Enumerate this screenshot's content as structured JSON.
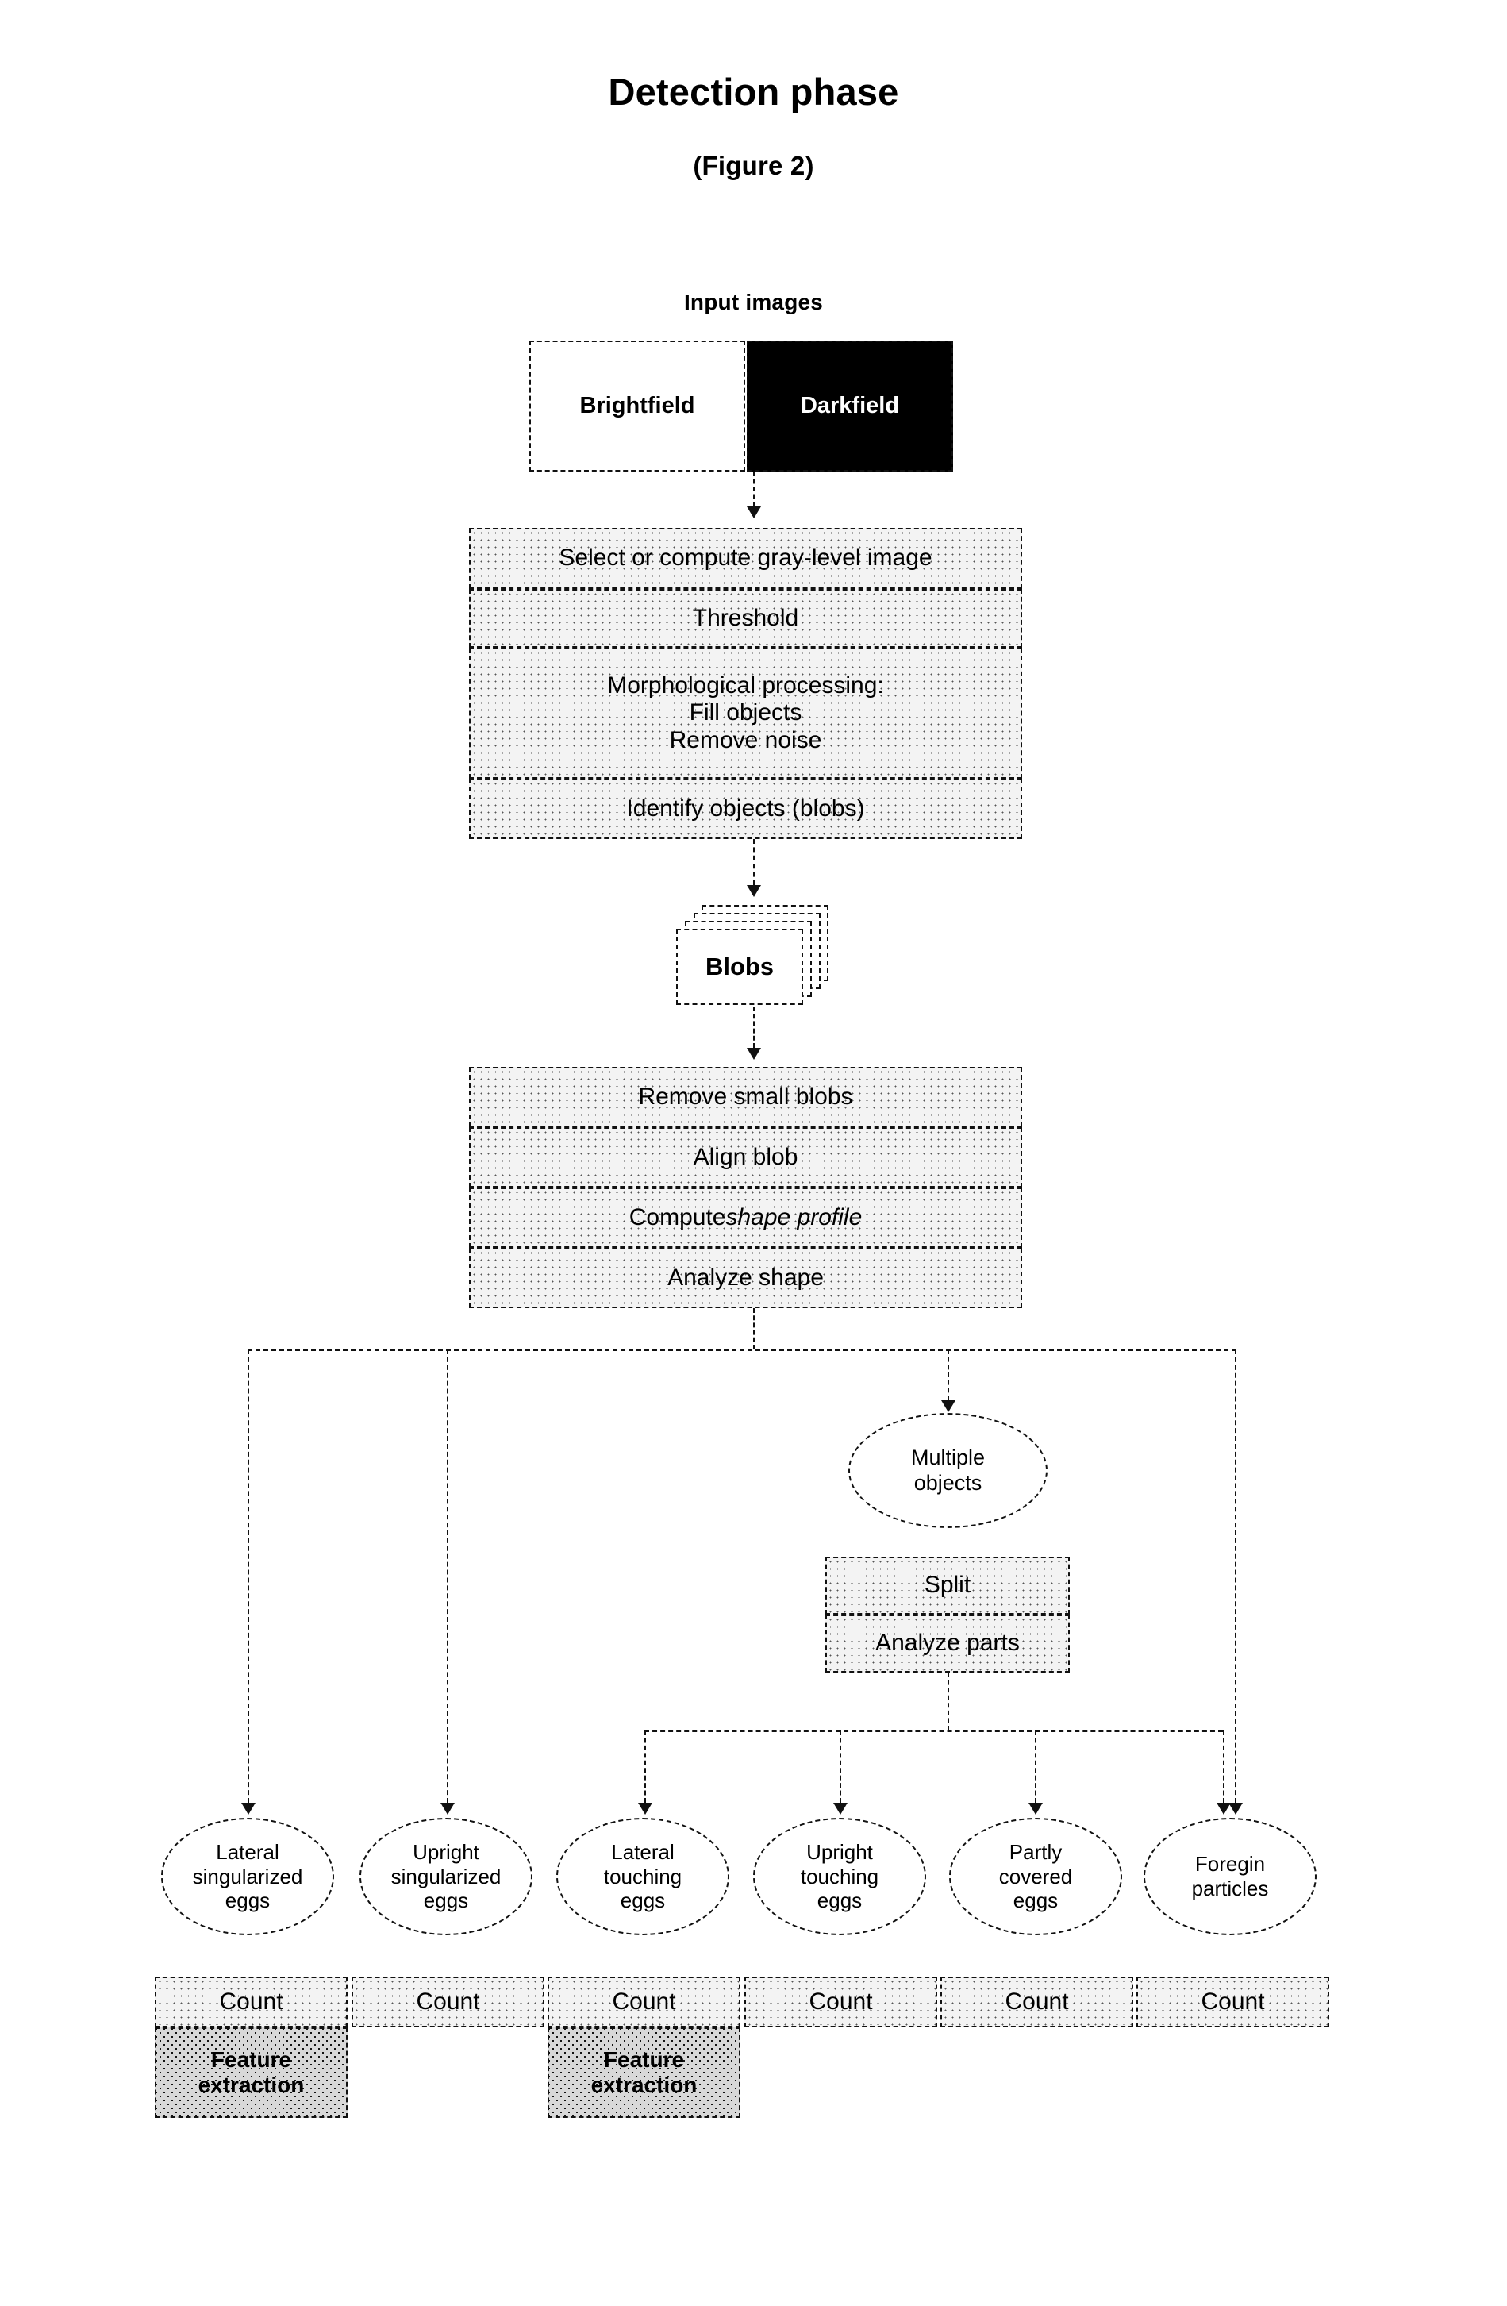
{
  "page": {
    "title": "Detection phase",
    "figure_ref": "(Figure 2)"
  },
  "input_section": {
    "label": "Input images",
    "brightfield": "Brightfield",
    "darkfield": "Darkfield"
  },
  "preprocessing_steps": [
    "Select or compute gray-level image",
    "Threshold",
    "Morphological processing:",
    "Fill objects",
    "Remove noise",
    "Identify objects (blobs)"
  ],
  "preprocessing": {
    "step1": "Select or compute gray-level image",
    "step2": "Threshold",
    "step3_line1": "Morphological processing:",
    "step3_line2": "Fill objects",
    "step3_line3": "Remove noise",
    "step4": "Identify objects (blobs)"
  },
  "blobs": {
    "label": "Blobs"
  },
  "shape_analysis": {
    "step1": "Remove small blobs",
    "step2": "Align blob",
    "step3_prefix": "Compute ",
    "step3_italic": "shape profile",
    "step4": "Analyze shape"
  },
  "multiple_objects": {
    "line1": "Multiple",
    "line2": "objects",
    "split": "Split",
    "analyze_parts": "Analyze parts"
  },
  "outcomes": [
    {
      "id": "lateral-singularized-eggs",
      "line1": "Lateral",
      "line2": "singularized",
      "line3": "eggs",
      "count": "Count",
      "feature_extraction_line1": "Feature",
      "feature_extraction_line2": "extraction",
      "has_feature_extraction": true
    },
    {
      "id": "upright-singularized-eggs",
      "line1": "Upright",
      "line2": "singularized",
      "line3": "eggs",
      "count": "Count",
      "feature_extraction_line1": "",
      "feature_extraction_line2": "",
      "has_feature_extraction": false
    },
    {
      "id": "lateral-touching-eggs",
      "line1": "Lateral",
      "line2": "touching",
      "line3": "eggs",
      "count": "Count",
      "feature_extraction_line1": "Feature",
      "feature_extraction_line2": "extraction",
      "has_feature_extraction": true
    },
    {
      "id": "upright-touching-eggs",
      "line1": "Upright",
      "line2": "touching",
      "line3": "eggs",
      "count": "Count",
      "feature_extraction_line1": "",
      "feature_extraction_line2": "",
      "has_feature_extraction": false
    },
    {
      "id": "partly-covered-eggs",
      "line1": "Partly",
      "line2": "covered",
      "line3": "eggs",
      "count": "Count",
      "feature_extraction_line1": "",
      "feature_extraction_line2": "",
      "has_feature_extraction": false
    },
    {
      "id": "foregin-particles",
      "line1": "Foregin",
      "line2": "particles",
      "line3": "",
      "count": "Count",
      "feature_extraction_line1": "",
      "feature_extraction_line2": "",
      "has_feature_extraction": false
    }
  ],
  "colors": {
    "box_fill": "#f3f3f3",
    "hatch_fill": "#d8d8d8",
    "dark_fill": "#000000",
    "stroke": "#111111",
    "text": "#000000",
    "dark_text": "#ffffff"
  }
}
